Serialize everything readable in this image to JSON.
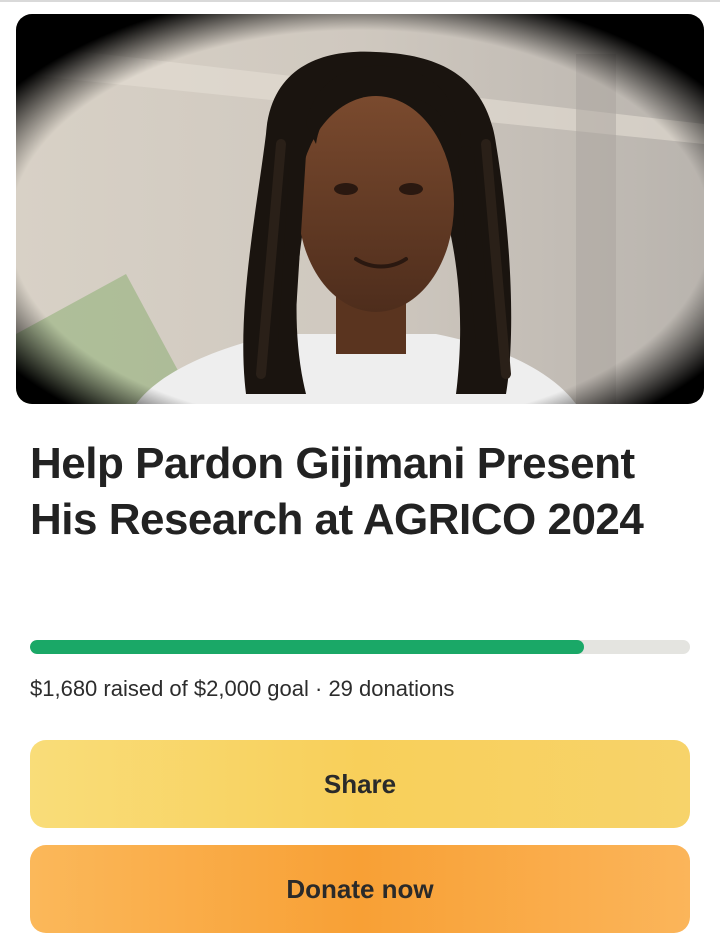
{
  "campaign": {
    "title": "Help Pardon Gijimani Present His Research at AGRICO 2024",
    "progress": {
      "raised": 1680,
      "goal": 2000,
      "fraction": 0.84,
      "summary": "$1,680 raised of $2,000 goal · 29 donations"
    }
  },
  "actions": {
    "share_label": "Share",
    "donate_label": "Donate now"
  },
  "colors": {
    "progress": "#1aa867",
    "track": "#e4e4e0",
    "share_button": "#f8d25f",
    "donate_button": "#f9a73f"
  }
}
